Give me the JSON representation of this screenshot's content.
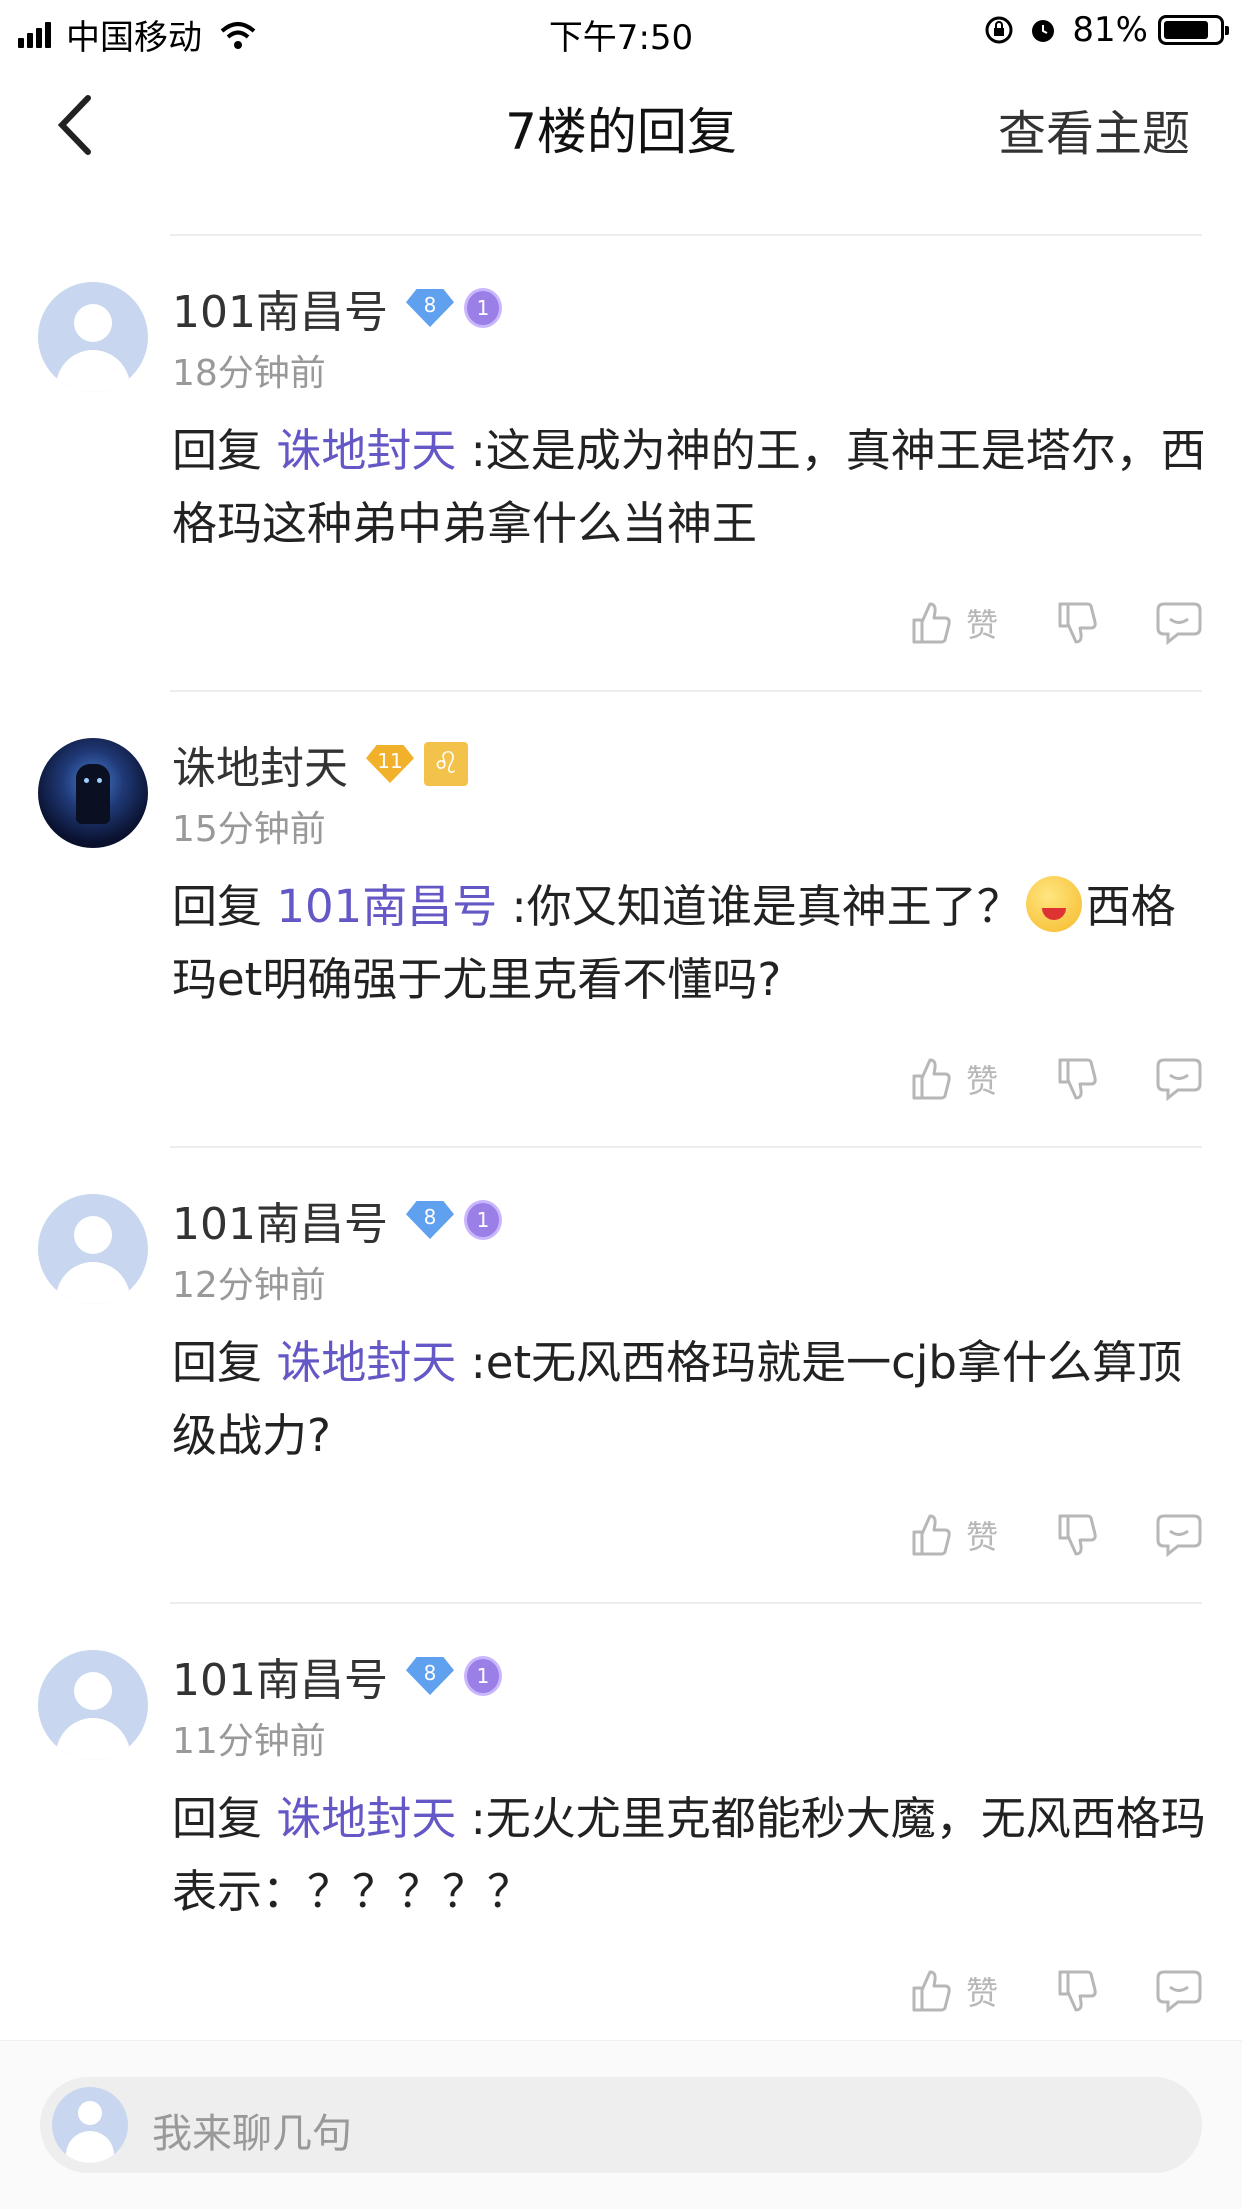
{
  "status_bar": {
    "carrier": "中国移动",
    "time": "下午7:50",
    "battery": "81%",
    "battery_level": 0.81
  },
  "nav": {
    "title": "7楼的回复",
    "right": "查看主题"
  },
  "replies": [
    {
      "user": "101南昌号",
      "level": "8",
      "medal": "1",
      "time": "18分钟前",
      "prefix": "回复 ",
      "mention": "诛地封天",
      "text": ":这是成为神的王，真神王是塔尔，西格玛这种弟中弟拿什么当神王",
      "text2": ""
    },
    {
      "user": "诛地封天",
      "level": "11",
      "zodiac": "♌",
      "time": "15分钟前",
      "prefix": "回复 ",
      "mention": "101南昌号",
      "text": ":你又知道谁是真神王了？",
      "text2": "西格玛et明确强于尤里克看不懂吗?"
    },
    {
      "user": "101南昌号",
      "level": "8",
      "medal": "1",
      "time": "12分钟前",
      "prefix": "回复 ",
      "mention": "诛地封天",
      "text": ":et无风西格玛就是一cjb拿什么算顶级战力?",
      "text2": ""
    },
    {
      "user": "101南昌号",
      "level": "8",
      "medal": "1",
      "time": "11分钟前",
      "prefix": "回复 ",
      "mention": "诛地封天",
      "text": ":无火尤里克都能秒大魔，无风西格玛表示：？？？？？",
      "text2": ""
    }
  ],
  "actions": {
    "like": "赞"
  },
  "input": {
    "placeholder": "我来聊几句"
  }
}
